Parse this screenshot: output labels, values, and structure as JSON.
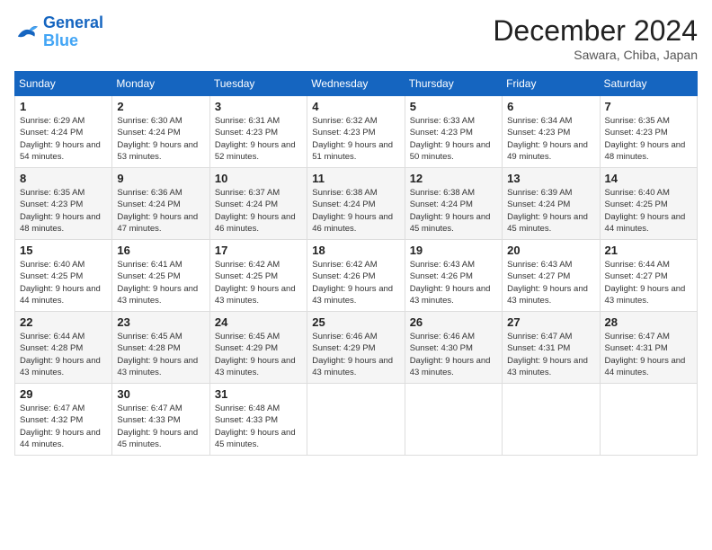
{
  "header": {
    "logo_line1": "General",
    "logo_line2": "Blue",
    "month_title": "December 2024",
    "location": "Sawara, Chiba, Japan"
  },
  "weekdays": [
    "Sunday",
    "Monday",
    "Tuesday",
    "Wednesday",
    "Thursday",
    "Friday",
    "Saturday"
  ],
  "weeks": [
    [
      {
        "day": "1",
        "sunrise": "6:29 AM",
        "sunset": "4:24 PM",
        "daylight": "9 hours and 54 minutes."
      },
      {
        "day": "2",
        "sunrise": "6:30 AM",
        "sunset": "4:24 PM",
        "daylight": "9 hours and 53 minutes."
      },
      {
        "day": "3",
        "sunrise": "6:31 AM",
        "sunset": "4:23 PM",
        "daylight": "9 hours and 52 minutes."
      },
      {
        "day": "4",
        "sunrise": "6:32 AM",
        "sunset": "4:23 PM",
        "daylight": "9 hours and 51 minutes."
      },
      {
        "day": "5",
        "sunrise": "6:33 AM",
        "sunset": "4:23 PM",
        "daylight": "9 hours and 50 minutes."
      },
      {
        "day": "6",
        "sunrise": "6:34 AM",
        "sunset": "4:23 PM",
        "daylight": "9 hours and 49 minutes."
      },
      {
        "day": "7",
        "sunrise": "6:35 AM",
        "sunset": "4:23 PM",
        "daylight": "9 hours and 48 minutes."
      }
    ],
    [
      {
        "day": "8",
        "sunrise": "6:35 AM",
        "sunset": "4:23 PM",
        "daylight": "9 hours and 48 minutes."
      },
      {
        "day": "9",
        "sunrise": "6:36 AM",
        "sunset": "4:24 PM",
        "daylight": "9 hours and 47 minutes."
      },
      {
        "day": "10",
        "sunrise": "6:37 AM",
        "sunset": "4:24 PM",
        "daylight": "9 hours and 46 minutes."
      },
      {
        "day": "11",
        "sunrise": "6:38 AM",
        "sunset": "4:24 PM",
        "daylight": "9 hours and 46 minutes."
      },
      {
        "day": "12",
        "sunrise": "6:38 AM",
        "sunset": "4:24 PM",
        "daylight": "9 hours and 45 minutes."
      },
      {
        "day": "13",
        "sunrise": "6:39 AM",
        "sunset": "4:24 PM",
        "daylight": "9 hours and 45 minutes."
      },
      {
        "day": "14",
        "sunrise": "6:40 AM",
        "sunset": "4:25 PM",
        "daylight": "9 hours and 44 minutes."
      }
    ],
    [
      {
        "day": "15",
        "sunrise": "6:40 AM",
        "sunset": "4:25 PM",
        "daylight": "9 hours and 44 minutes."
      },
      {
        "day": "16",
        "sunrise": "6:41 AM",
        "sunset": "4:25 PM",
        "daylight": "9 hours and 43 minutes."
      },
      {
        "day": "17",
        "sunrise": "6:42 AM",
        "sunset": "4:25 PM",
        "daylight": "9 hours and 43 minutes."
      },
      {
        "day": "18",
        "sunrise": "6:42 AM",
        "sunset": "4:26 PM",
        "daylight": "9 hours and 43 minutes."
      },
      {
        "day": "19",
        "sunrise": "6:43 AM",
        "sunset": "4:26 PM",
        "daylight": "9 hours and 43 minutes."
      },
      {
        "day": "20",
        "sunrise": "6:43 AM",
        "sunset": "4:27 PM",
        "daylight": "9 hours and 43 minutes."
      },
      {
        "day": "21",
        "sunrise": "6:44 AM",
        "sunset": "4:27 PM",
        "daylight": "9 hours and 43 minutes."
      }
    ],
    [
      {
        "day": "22",
        "sunrise": "6:44 AM",
        "sunset": "4:28 PM",
        "daylight": "9 hours and 43 minutes."
      },
      {
        "day": "23",
        "sunrise": "6:45 AM",
        "sunset": "4:28 PM",
        "daylight": "9 hours and 43 minutes."
      },
      {
        "day": "24",
        "sunrise": "6:45 AM",
        "sunset": "4:29 PM",
        "daylight": "9 hours and 43 minutes."
      },
      {
        "day": "25",
        "sunrise": "6:46 AM",
        "sunset": "4:29 PM",
        "daylight": "9 hours and 43 minutes."
      },
      {
        "day": "26",
        "sunrise": "6:46 AM",
        "sunset": "4:30 PM",
        "daylight": "9 hours and 43 minutes."
      },
      {
        "day": "27",
        "sunrise": "6:47 AM",
        "sunset": "4:31 PM",
        "daylight": "9 hours and 43 minutes."
      },
      {
        "day": "28",
        "sunrise": "6:47 AM",
        "sunset": "4:31 PM",
        "daylight": "9 hours and 44 minutes."
      }
    ],
    [
      {
        "day": "29",
        "sunrise": "6:47 AM",
        "sunset": "4:32 PM",
        "daylight": "9 hours and 44 minutes."
      },
      {
        "day": "30",
        "sunrise": "6:47 AM",
        "sunset": "4:33 PM",
        "daylight": "9 hours and 45 minutes."
      },
      {
        "day": "31",
        "sunrise": "6:48 AM",
        "sunset": "4:33 PM",
        "daylight": "9 hours and 45 minutes."
      },
      null,
      null,
      null,
      null
    ]
  ]
}
